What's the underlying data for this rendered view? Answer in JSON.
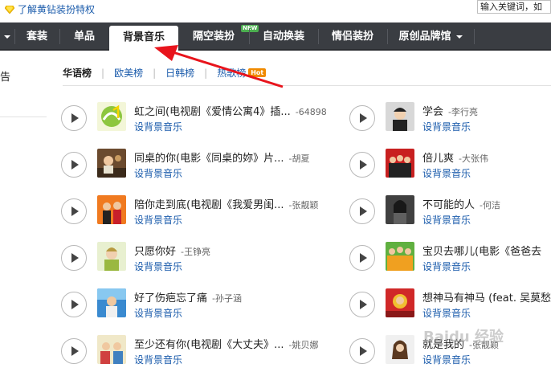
{
  "topbar": {
    "vip_link": "了解黄钻装扮特权",
    "search_placeholder": "输入关键词，如"
  },
  "nav": {
    "items": [
      "套装",
      "单品",
      "背景音乐",
      "隔空装扮",
      "自动换装",
      "情侣装扮",
      "原创品牌馆"
    ],
    "active_index": 2,
    "new_badge": "NEW"
  },
  "left": {
    "text": "告"
  },
  "subtabs": {
    "items": [
      "华语榜",
      "欧美榜",
      "日韩榜",
      "热歌榜"
    ],
    "active_index": 0,
    "hot_badge": "Hot"
  },
  "songs": {
    "action_label": "设背景音乐",
    "left": [
      {
        "title": "虹之间(电视剧《爱情公寓4》插...",
        "artist": "-64898"
      },
      {
        "title": "同桌的你(电影《同桌的妳》片...",
        "artist": "-胡夏"
      },
      {
        "title": "陪你走到底(电视剧《我爱男闺...",
        "artist": "-张靓颖"
      },
      {
        "title": "只愿你好",
        "artist": "-王铮亮"
      },
      {
        "title": "好了伤疤忘了痛",
        "artist": "-孙子涵"
      },
      {
        "title": "至少还有你(电视剧《大丈夫》...",
        "artist": "-姚贝娜"
      }
    ],
    "right": [
      {
        "title": "学会",
        "artist": "-李行亮"
      },
      {
        "title": "倍儿爽",
        "artist": "-大张伟"
      },
      {
        "title": "不可能的人",
        "artist": "-何洁"
      },
      {
        "title": "宝贝去哪儿(电影《爸爸去",
        "artist": ""
      },
      {
        "title": "想神马有神马 (feat. 吴莫愁",
        "artist": ""
      },
      {
        "title": "就是我的",
        "artist": "-张靓颖"
      }
    ]
  },
  "watermark": "Baidu 经验",
  "colors": {
    "nav_bg": "#3a3d42",
    "link": "#1a5bab",
    "arrow": "#e8141c",
    "hot": "#f08a00"
  }
}
